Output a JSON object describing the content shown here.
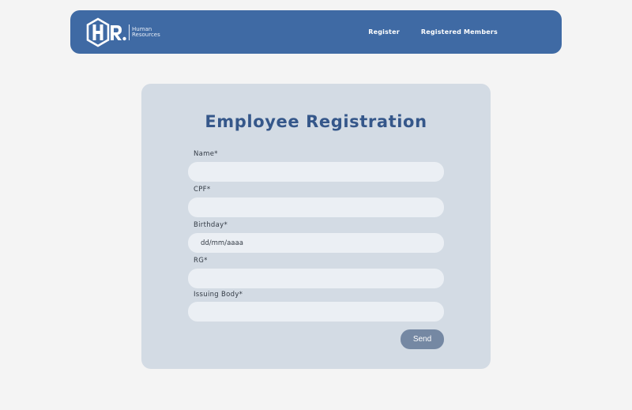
{
  "header": {
    "logo_letters": "HR",
    "logo_line1": "Human",
    "logo_line2": "Resources",
    "nav": [
      {
        "label": "Register"
      },
      {
        "label": "Registered Members"
      }
    ],
    "color": "#3f6aa4"
  },
  "form": {
    "title": "Employee Registration",
    "fields": [
      {
        "label": "Name*",
        "value": "",
        "placeholder": ""
      },
      {
        "label": "CPF*",
        "value": "",
        "placeholder": ""
      },
      {
        "label": "Birthday*",
        "value": "",
        "placeholder": "dd/mm/aaaa"
      },
      {
        "label": "RG*",
        "value": "",
        "placeholder": ""
      },
      {
        "label": "Issuing Body*",
        "value": "",
        "placeholder": ""
      }
    ],
    "submit_label": "Send",
    "title_color": "#35578a",
    "button_color": "#7588a3"
  }
}
